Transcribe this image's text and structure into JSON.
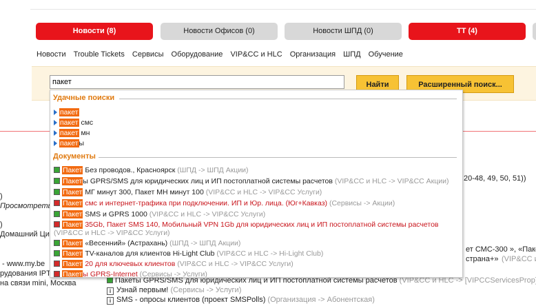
{
  "tabs": [
    {
      "label": "Новости (8)",
      "style": "red"
    },
    {
      "label": "Новости Офисов (0)",
      "style": "grey"
    },
    {
      "label": "Новости ШПД (0)",
      "style": "grey"
    },
    {
      "label": "TT (4)",
      "style": "red"
    }
  ],
  "nav": [
    "Новости",
    "Trouble Tickets",
    "Сервисы",
    "Оборудование",
    "VIP&CC и HLC",
    "Организация",
    "ШПД",
    "Обучение"
  ],
  "search": {
    "value": "пакет",
    "find_label": "Найти",
    "advanced_label": "Расширенный поиск..."
  },
  "dropdown": {
    "saved_title": "Удачные поиски",
    "saved": [
      {
        "hl": "пакет",
        "rest": ""
      },
      {
        "hl": "пакет",
        "rest": " смс"
      },
      {
        "hl": "пакет",
        "rest": " мн"
      },
      {
        "hl": "пакет",
        "rest": "ы"
      }
    ],
    "docs_title": "Документы",
    "docs": [
      {
        "hl": "Пакет",
        "rest": " Без проводов., Красноярск",
        "path": "(ШПД -> ШПД Акции)",
        "color": "normal",
        "icon": "green"
      },
      {
        "hl": "Пакет",
        "rest": "ы GPRS/SMS для юридических лиц и ИП постоплатной системы расчетов",
        "path": "(VIP&CC и HLC -> VIP&CC Акции)",
        "color": "normal",
        "icon": "green"
      },
      {
        "hl": "Пакет",
        "rest": " МГ минут 300, Пакет МН минут 100",
        "path": "(VIP&CC и HLC -> VIP&CC Услуги)",
        "color": "normal",
        "icon": "green"
      },
      {
        "hl": "Пакет",
        "rest": " смс и интернет-трафика при подключении. ИП и Юр. лица. (Юг+Кавказ)",
        "path": "(Сервисы -> Акции)",
        "color": "red",
        "icon": "red"
      },
      {
        "hl": "Пакет",
        "rest": " SMS и GPRS 1000",
        "path": "(VIP&CC и HLC -> VIP&CC Услуги)",
        "color": "normal",
        "icon": "green"
      },
      {
        "hl": "Пакет",
        "rest": " 35Gb, Пакет SMS 140, Мобильный VPN 1Gb для юридических лиц и ИП постоплатной системы расчетов",
        "path": "(VIP&CC и HLC -> VIP&CC Услуги)",
        "color": "red",
        "icon": "red",
        "wrap": true
      },
      {
        "hl": "Пакет",
        "rest": " «Весенний» (Астрахань)",
        "path": "(ШПД -> ШПД Акции)",
        "color": "normal",
        "icon": "green"
      },
      {
        "hl": "Пакет",
        "rest": " TV-каналов для клиентов Hi-Light Club",
        "path": "(VIP&CC и HLC -> Hi-Light Club)",
        "color": "normal",
        "icon": "green"
      },
      {
        "hl": "Пакет",
        "rest": " 20 для ключевых клиентов",
        "path": "(VIP&CC и HLC -> VIP&CC Услуги)",
        "color": "red",
        "icon": "red"
      },
      {
        "hl": "Пакет",
        "rest": "ы GPRS-Internet",
        "path": "(Сервисы -> Услуги)",
        "color": "red",
        "icon": "red"
      }
    ]
  },
  "background": {
    "right_numbers": "20-48, 49, 50, 51))",
    "left_prosmotr": "Просмотреть",
    "left_paren1": ")",
    "left_paren2": ")",
    "left_home": "Домашний Ци",
    "left_www": "- www.my.be",
    "left_iptv": "рудования IPT",
    "left_mini": "на связи mini, Москва",
    "right_sms300": "ет СМС-300 », «Пакет",
    "right_strana": "страна+»",
    "right_vipcc": "(VIP&CC и",
    "below1_text": "Пакеты GPRS/SMS для юридических лиц и ИП постоплатной системы расчетов",
    "below1_path": "(VIP&CC и HLC -> [VIPCCServicesProp]",
    "below2_text": "Узнай первым!",
    "below2_path": "(Сервисы -> Услуги)",
    "below3_text": "SMS - опросы клиентов (проект SMSPolls)",
    "below3_path": "(Организация -> Абонентская)"
  }
}
